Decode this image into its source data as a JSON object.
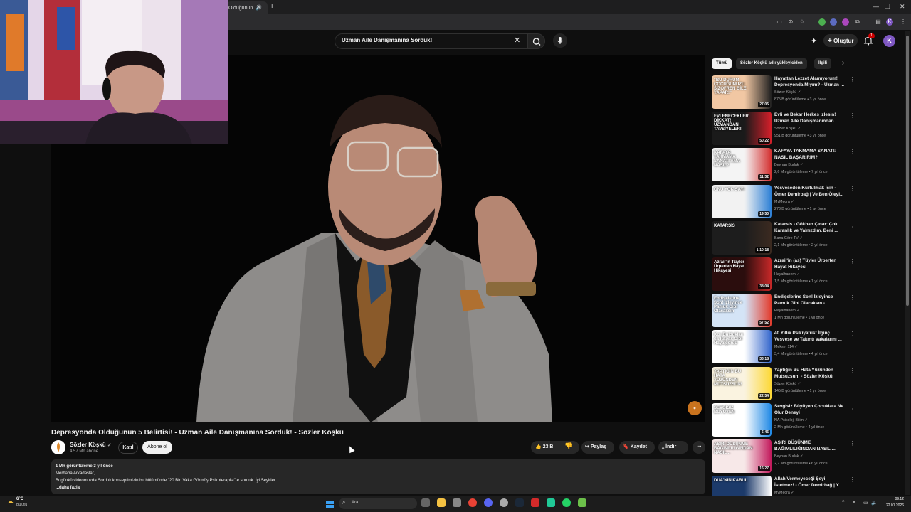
{
  "browser": {
    "tab_title": "Olduğunun",
    "tab_sound_icon": "speaker-icon",
    "window_controls": [
      "—",
      "❐",
      "✕"
    ]
  },
  "header": {
    "search_query": "Uzman Aile Danışmanına Sorduk!",
    "create_label": "Oluştur",
    "notifications_badge": "1",
    "avatar_letter": "K"
  },
  "video": {
    "title": "Depresyonda Olduğunun 5 Belirtisi! - Uzman Aile Danışmanına Sorduk! - Sözler Köşkü",
    "channel_name": "Sözler Köşkü",
    "subscribers": "4,57 Mn abone",
    "join_label": "Katıl",
    "subscribe_label": "Abone ol",
    "likes": "23 B",
    "share_label": "Paylaş",
    "save_label": "Kaydet",
    "download_label": "İndir",
    "more_label": "⋯",
    "description": {
      "meta": "1 Mn görüntüleme  3 yıl önce",
      "line1": "Merhaba Arkadaşlar,",
      "line2": "Bugünkü videomuzda Sorduk konseptimizin bu bölümünde \"20 Bin Vaka Görmüş Psikoterapist\" e sorduk. İyi Seyirler...",
      "more": "...daha fazla"
    }
  },
  "filters": {
    "all": "Tümü",
    "channel": "Sözler Köşkü adlı yükleyiciden",
    "related": "İlgili"
  },
  "recommendations": [
    {
      "title": "Hayattan Lezzet Alamıyorum! Depresyonda Mıyım? - Uzman ...",
      "channel": "Sözler Köşkü",
      "meta": "875 B görüntüleme • 3 yıl önce",
      "duration": "27:05",
      "thumb_text": "\"BU DURUM ÇOCUĞUNUZU ŞİZOFREN BİLE YAPAR!\""
    },
    {
      "title": "Evli ve Bekar Herkes İzlesin! Uzman Aile Danışmanından ...",
      "channel": "Sözler Köşkü",
      "meta": "951 B görüntüleme • 3 yıl önce",
      "duration": "50:22",
      "thumb_text": "EVLENECEKLER DİKKAT! UZMANDAN TAVSİYELER!"
    },
    {
      "title": "KAFAYA TAKMAMA SANATI: NASIL BAŞARIRIM?",
      "channel": "Beyhan Budak",
      "meta": "2,6 Mn görüntüleme • 7 yıl önce",
      "duration": "11:32",
      "thumb_text": "KAFAYA TAKMAMA SANATI AMA NASIL?"
    },
    {
      "title": "Vesveseden Kurtulmak İçin - Ömer Demirbağ | Ve Ben Öleyi...",
      "channel": "MyMecra",
      "meta": "273 B görüntüleme • 1 ay önce",
      "duration": "19:50",
      "thumb_text": "ONU YOK SAY!"
    },
    {
      "title": "Katarsis - Gökhan Çınar: Çok Karanlık ve Yalnızdım. Beni ...",
      "channel": "Bana Göre TV",
      "meta": "2,1 Mn görüntüleme • 2 yıl önce",
      "duration": "1:10:18",
      "thumb_text": "KATARSİS"
    },
    {
      "title": "Azrail'in (as) Tüyler Ürperten Hayat Hikayesi",
      "channel": "Hayalhanem",
      "meta": "1,5 Mn görüntüleme • 1 yıl önce",
      "duration": "38:04",
      "thumb_text": "Azrail'in Tüyler Ürperten Hayat Hikayesi"
    },
    {
      "title": "Endişelerine Son! İzleyince Pamuk Gibi Olacaksın - ...",
      "channel": "Hayalhanem",
      "meta": "1 Mn görüntüleme • 1 yıl önce",
      "duration": "57:52",
      "thumb_text": "Endişelerine Son! İzleyince Pamuk Gibi Olacaksın"
    },
    {
      "title": "40 Yıllık Psikiyatrist İlginç Vesvese ve Takıntı Vakalarını ...",
      "channel": "Mekset 114",
      "meta": "3,4 Mn görüntüleme • 4 yıl önce",
      "duration": "33:18",
      "thumb_text": "Kızı Buldukları da Kapak Gibi Hayalgördü"
    },
    {
      "title": "Yaptığın Bu Hata Yüzünden Mutsuzsun! - Sözler Köşkü",
      "channel": "Sözler Köşkü",
      "meta": "145 B görüntüleme • 1 yıl önce",
      "duration": "22:54",
      "thumb_text": "YAPTIĞIN BU HATA YÜZÜNDEN MUTSUZSUN!"
    },
    {
      "title": "Sevgisiz Büyüyen Çocuklara Ne Olur Deneyi",
      "channel": "NA Psikoloji Bilim",
      "meta": "2 Mn görüntüleme • 4 yıl önce",
      "duration": "6:45",
      "thumb_text": "SEVGİSİZ BÜYÜYEN"
    },
    {
      "title": "AŞIRI DÜŞÜNME BAĞIMLILIĞINDAN NASIL ...",
      "channel": "Beyhan Budak",
      "meta": "2,7 Mn görüntüleme • 6 yıl önce",
      "duration": "16:27",
      "thumb_text": "AŞIRI DÜŞÜNME BAĞIMLILIĞINDAN NASIL..."
    },
    {
      "title": "Allah Vermeyeceği Şeyi İstetmez! - Ömer Demirbağ | Y...",
      "channel": "MyMecra",
      "meta": "",
      "duration": "",
      "thumb_text": "DUA'NIN KABUL"
    }
  ],
  "taskbar": {
    "weather_temp": "6°C",
    "weather_desc": "Bulutlu",
    "search_placeholder": "Ara",
    "time": "09:12",
    "date": "22.01.2026"
  },
  "colors": {
    "background": "#0f0f0f",
    "accent_red": "#cc0000",
    "chip_active": "#f1f1f1"
  }
}
